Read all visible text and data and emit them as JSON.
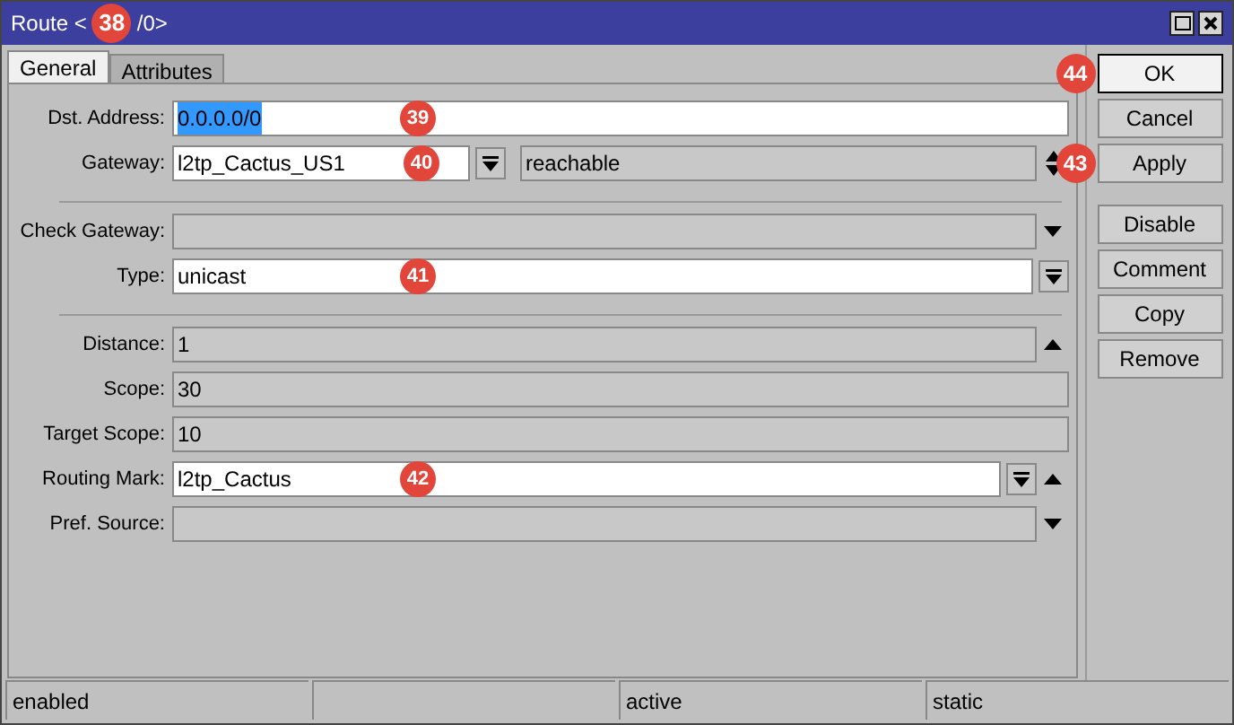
{
  "window": {
    "title_parts": [
      "Route <",
      "/0>"
    ],
    "badge": "38"
  },
  "tabs": [
    {
      "label": "General",
      "selected": true
    },
    {
      "label": "Attributes",
      "selected": false
    }
  ],
  "rows": [
    {
      "kind": "field",
      "label": "Dst. Address:",
      "value": "0.0.0.0/0",
      "editable": true,
      "highlighted": true,
      "arrow_up": false,
      "arrow_down": false,
      "badge": "39"
    },
    {
      "kind": "gateway",
      "label": "Gateway:",
      "value": "l2tp_Cactus_US1",
      "editable": true,
      "status": "reachable",
      "arrow_up": true,
      "arrow_down": true,
      "badge": "40"
    },
    {
      "kind": "divider"
    },
    {
      "kind": "field",
      "label": "Check Gateway:",
      "editable": false,
      "arrow_up": false,
      "arrow_down": true
    },
    {
      "kind": "select",
      "label": "Type:",
      "value": "unicast",
      "editable": true,
      "arrow_up": false,
      "arrow_down": false,
      "badge": "41"
    },
    {
      "kind": "divider"
    },
    {
      "kind": "field",
      "label": "Distance:",
      "value": "1",
      "editable": false,
      "arrow_up": true,
      "arrow_down": false
    },
    {
      "kind": "field",
      "label": "Scope:",
      "value": "30",
      "editable": false,
      "arrow_up": false,
      "arrow_down": false
    },
    {
      "kind": "field",
      "label": "Target Scope:",
      "value": "10",
      "editable": false,
      "arrow_up": false,
      "arrow_down": false
    },
    {
      "kind": "select",
      "label": "Routing Mark:",
      "value": "l2tp_Cactus",
      "editable": true,
      "arrow_up": true,
      "arrow_down": false,
      "badge": "42"
    },
    {
      "kind": "field",
      "label": "Pref. Source:",
      "editable": false,
      "arrow_up": false,
      "arrow_down": true
    }
  ],
  "buttons": [
    {
      "label": "OK",
      "default": true,
      "badge": "44"
    },
    {
      "label": "Cancel",
      "default": false
    },
    {
      "label": "Apply",
      "default": false,
      "badge": "43"
    },
    {
      "label": "Disable",
      "default": false
    },
    {
      "label": "Comment",
      "default": false
    },
    {
      "label": "Copy",
      "default": false
    },
    {
      "label": "Remove",
      "default": false
    }
  ],
  "status_bar": {
    "column_1": "enabled",
    "column_3": "active",
    "column_4": "static"
  }
}
